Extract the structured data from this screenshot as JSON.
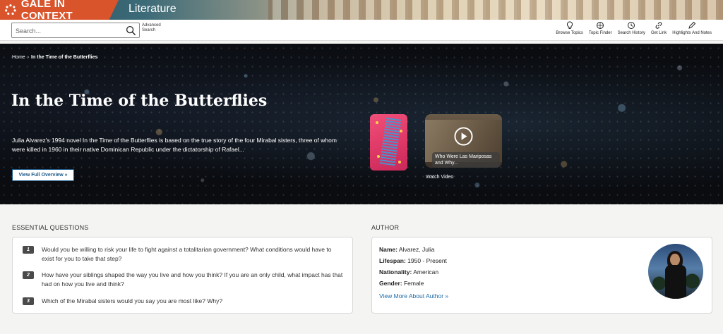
{
  "brand": {
    "name": "GALE IN CONTEXT",
    "product": "Literature",
    "accent": "#d9532b"
  },
  "search": {
    "placeholder": "Search...",
    "advanced_label": "Advanced Search"
  },
  "tools": [
    {
      "label": "Browse Topics",
      "icon": "lightbulb-icon"
    },
    {
      "label": "Topic Finder",
      "icon": "topic-finder-icon"
    },
    {
      "label": "Search History",
      "icon": "history-icon"
    },
    {
      "label": "Get Link",
      "icon": "link-icon"
    },
    {
      "label": "Highlights And Notes",
      "icon": "pencil-icon"
    }
  ],
  "breadcrumb": {
    "home": "Home",
    "current": "In the Time of the Butterflies"
  },
  "hero": {
    "title": "In the Time of the Butterflies",
    "description": "Julia Alvarez's 1994 novel In the Time of the Butterflies is based on the true story of the four Mirabal sisters, three of whom were killed in 1960 in their native Dominican Republic under the dictatorship of Rafael...",
    "overview_button": "View Full Overview »",
    "video_caption": "Who Were Las Mariposas and Why...",
    "watch_label": "Watch Video"
  },
  "essential_questions": {
    "heading": "ESSENTIAL QUESTIONS",
    "items": [
      {
        "num": "1",
        "text": "Would you be willing to risk your life to fight against a totalitarian government? What conditions would have to exist for you to take that step?"
      },
      {
        "num": "2",
        "text": "How have your siblings shaped the way you live and how you think? If you are an only child, what impact has that had on how you live and think?"
      },
      {
        "num": "3",
        "text": "Which of the Mirabal sisters would you say you are most like? Why?"
      }
    ]
  },
  "author": {
    "heading": "AUTHOR",
    "name_label": "Name:",
    "name": "Alvarez, Julia",
    "lifespan_label": "Lifespan:",
    "lifespan": "1950 - Present",
    "nationality_label": "Nationality:",
    "nationality": "American",
    "gender_label": "Gender:",
    "gender": "Female",
    "more_link": "View More About Author »"
  }
}
